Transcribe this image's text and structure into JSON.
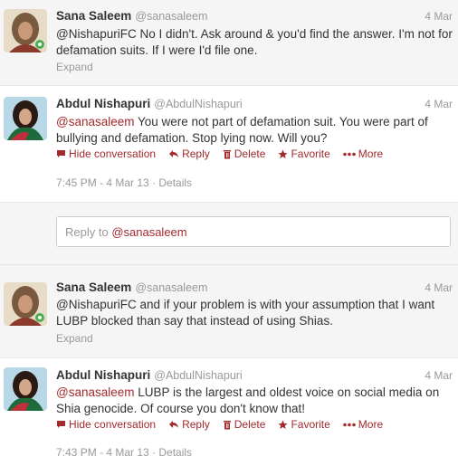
{
  "tweets": [
    {
      "name": "Sana Saleem",
      "handle": "@sanasaleem",
      "date": "4 Mar",
      "text": "@NishapuriFC No I didn't. Ask around & you'd find the answer. I'm not for defamation suits. If I were I'd file one.",
      "expand": "Expand"
    },
    {
      "name": "Abdul Nishapuri",
      "handle": "@AbdulNishapuri",
      "date": "4 Mar",
      "mention": "@sanasaleem",
      "text": " You were not part of defamation suit. You were part of bullying and defamation. Stop lying now. Will you?",
      "actions": {
        "hide": "Hide conversation",
        "reply": "Reply",
        "delete": "Delete",
        "favorite": "Favorite",
        "more": "More"
      },
      "meta": "7:45 PM - 4 Mar 13 · Details"
    },
    {
      "name": "Sana Saleem",
      "handle": "@sanasaleem",
      "date": "4 Mar",
      "text": "@NishapuriFC and if your problem is with your assumption that I want LUBP blocked than say that instead of using Shias.",
      "expand": "Expand"
    },
    {
      "name": "Abdul Nishapuri",
      "handle": "@AbdulNishapuri",
      "date": "4 Mar",
      "mention": "@sanasaleem",
      "text": " LUBP is the largest and oldest voice on social media on Shia genocide. Of course you don't know that!",
      "actions": {
        "hide": "Hide conversation",
        "reply": "Reply",
        "delete": "Delete",
        "favorite": "Favorite",
        "more": "More"
      },
      "meta": "7:43 PM - 4 Mar 13 · Details"
    }
  ],
  "reply_box": {
    "prefix": "Reply to ",
    "mention": "@sanasaleem"
  },
  "colors": {
    "accent": "#a32a2d",
    "muted": "#999999"
  }
}
